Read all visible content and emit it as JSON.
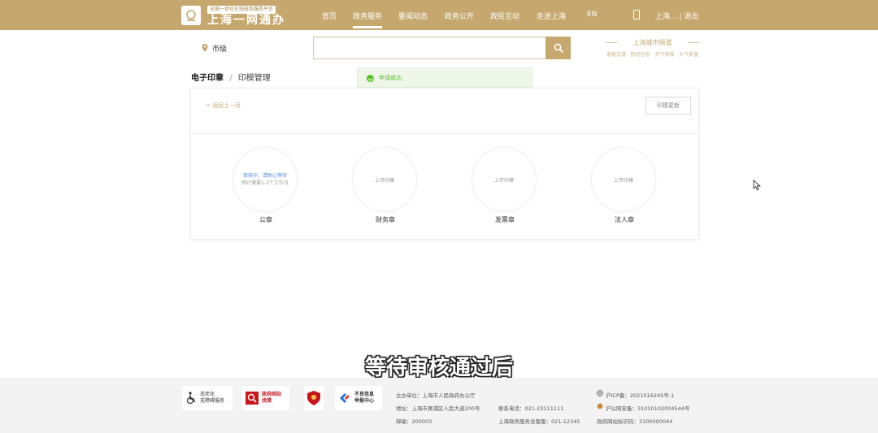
{
  "header": {
    "logo_tag": "全国一体化在线政务服务平台",
    "logo_title": "上海一网通办",
    "nav": [
      {
        "label": "首页"
      },
      {
        "label": "政务服务"
      },
      {
        "label": "要闻动态"
      },
      {
        "label": "政务公开"
      },
      {
        "label": "政民互动"
      },
      {
        "label": "走进上海"
      },
      {
        "label": "EN"
      }
    ],
    "active_nav": "政务服务",
    "user_links": "上海... | 退出"
  },
  "search": {
    "location": "市级",
    "placeholder": ""
  },
  "brand": {
    "title": "上海城市频道",
    "subtitle": "道路交通 · 航班信息 · 天气预报 · 大气质量"
  },
  "breadcrumb": {
    "parent": "电子印章",
    "separator": "/",
    "current": "印模管理"
  },
  "toast": {
    "text": "申请成功",
    "color": "#52c41a"
  },
  "card": {
    "back_label": "< 返回上一页",
    "update_button": "印模更新",
    "seals": [
      {
        "name": "公章",
        "status": "审核中，请耐心等待",
        "sub": "预计需要1-2个工作日"
      },
      {
        "name": "财务章",
        "upload": "上传印模"
      },
      {
        "name": "发票章",
        "upload": "上传印模"
      },
      {
        "name": "法人章",
        "upload": "上传印模"
      }
    ]
  },
  "caption": "等待审核通过后",
  "footer": {
    "badges": [
      {
        "text": "适老化\n无障碍服务"
      },
      {
        "text": "政府网站\n找错"
      },
      {
        "text": ""
      },
      {
        "text": "不良信息\n举报中心"
      }
    ],
    "host": "主办单位：上海市人民政府办公厅",
    "address": "地址：上海市黄浦区人民大道200号",
    "postcode": "邮编：200003",
    "phone": "联系电话：021-23111111",
    "hotline": "上海政务服务总客服：021-12345",
    "icp": "沪ICP备：2021016245号-1",
    "police": "沪公网安备：31010102004544号",
    "site_id": "政府网站标识码：3100000044"
  },
  "colors": {
    "brand_gold": "#c6a86e",
    "status_blue": "#4a90e2"
  }
}
